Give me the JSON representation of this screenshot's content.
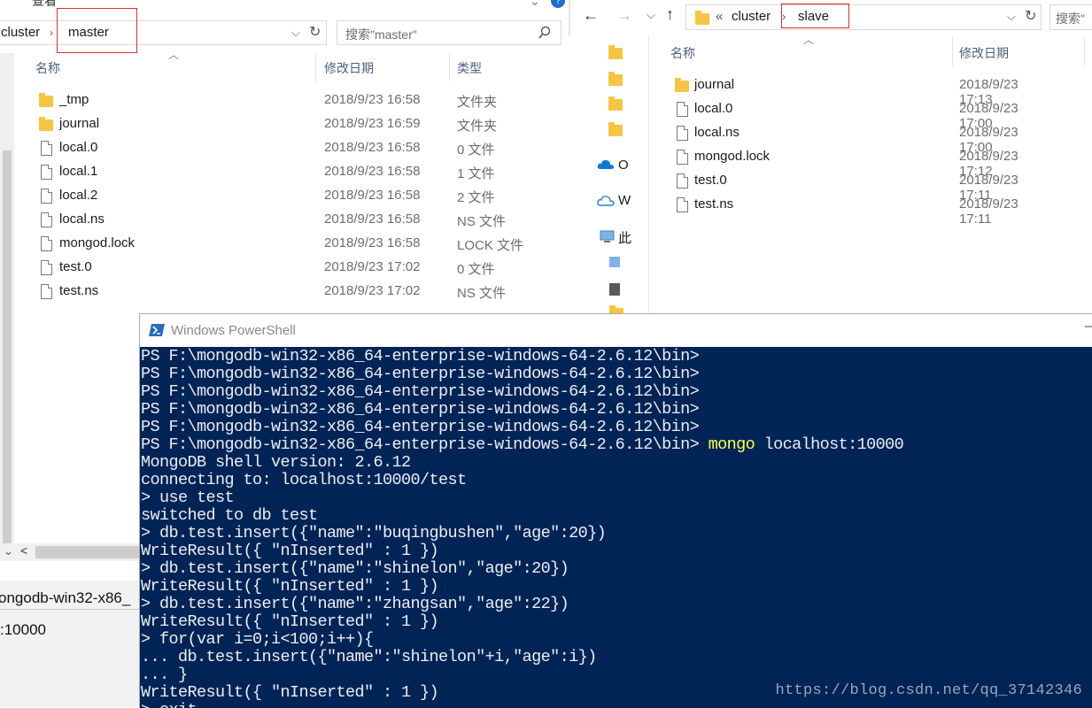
{
  "left_explorer": {
    "menu_label": "查看",
    "path": {
      "parent": "cluster",
      "current": "master"
    },
    "search_placeholder": "搜索\"master\"",
    "columns": {
      "name": "名称",
      "date": "修改日期",
      "type": "类型"
    },
    "files": [
      {
        "name": "_tmp",
        "date": "2018/9/23 16:58",
        "type": "文件夹",
        "kind": "folder"
      },
      {
        "name": "journal",
        "date": "2018/9/23 16:59",
        "type": "文件夹",
        "kind": "folder"
      },
      {
        "name": "local.0",
        "date": "2018/9/23 16:58",
        "type": "0 文件",
        "kind": "file"
      },
      {
        "name": "local.1",
        "date": "2018/9/23 16:58",
        "type": "1 文件",
        "kind": "file"
      },
      {
        "name": "local.2",
        "date": "2018/9/23 16:58",
        "type": "2 文件",
        "kind": "file"
      },
      {
        "name": "local.ns",
        "date": "2018/9/23 16:58",
        "type": "NS 文件",
        "kind": "file"
      },
      {
        "name": "mongod.lock",
        "date": "2018/9/23 16:58",
        "type": "LOCK 文件",
        "kind": "file"
      },
      {
        "name": "test.0",
        "date": "2018/9/23 17:02",
        "type": "0 文件",
        "kind": "file"
      },
      {
        "name": "test.ns",
        "date": "2018/9/23 17:02",
        "type": "NS 文件",
        "kind": "file"
      }
    ],
    "bottom_window_text_1": "ongodb-win32-x86_",
    "bottom_window_text_2": ":10000"
  },
  "right_explorer": {
    "path": {
      "overflow": "«",
      "parent": "cluster",
      "current": "slave"
    },
    "search_placeholder": "搜索\"",
    "columns": {
      "name": "名称",
      "date": "修改日期"
    },
    "nav_items": [
      "O",
      "W",
      "此"
    ],
    "files": [
      {
        "name": "journal",
        "date": "2018/9/23 17:13",
        "kind": "folder"
      },
      {
        "name": "local.0",
        "date": "2018/9/23 17:00",
        "kind": "file"
      },
      {
        "name": "local.ns",
        "date": "2018/9/23 17:00",
        "kind": "file"
      },
      {
        "name": "mongod.lock",
        "date": "2018/9/23 17:12",
        "kind": "file"
      },
      {
        "name": "test.0",
        "date": "2018/9/23 17:11",
        "kind": "file"
      },
      {
        "name": "test.ns",
        "date": "2018/9/23 17:11",
        "kind": "file"
      }
    ]
  },
  "powershell": {
    "title": "Windows PowerShell",
    "minimize_glyph": "—",
    "lines": [
      "PS F:\\mongodb-win32-x86_64-enterprise-windows-64-2.6.12\\bin>",
      "PS F:\\mongodb-win32-x86_64-enterprise-windows-64-2.6.12\\bin>",
      "PS F:\\mongodb-win32-x86_64-enterprise-windows-64-2.6.12\\bin>",
      "PS F:\\mongodb-win32-x86_64-enterprise-windows-64-2.6.12\\bin>",
      "PS F:\\mongodb-win32-x86_64-enterprise-windows-64-2.6.12\\bin>",
      "PS F:\\mongodb-win32-x86_64-enterprise-windows-64-2.6.12\\bin> ",
      "MongoDB shell version: 2.6.12",
      "connecting to: localhost:10000/test",
      "> use test",
      "switched to db test",
      "> db.test.insert({\"name\":\"buqingbushen\",\"age\":20})",
      "WriteResult({ \"nInserted\" : 1 })",
      "> db.test.insert({\"name\":\"shinelon\",\"age\":20})",
      "WriteResult({ \"nInserted\" : 1 })",
      "> db.test.insert({\"name\":\"zhangsan\",\"age\":22})",
      "WriteResult({ \"nInserted\" : 1 })",
      "> for(var i=0;i<100;i++){",
      "... db.test.insert({\"name\":\"shinelon\"+i,\"age\":i})",
      "... }",
      "WriteResult({ \"nInserted\" : 1 })",
      "> exit"
    ],
    "command_keyword": "mongo",
    "command_args": " localhost:10000",
    "watermark": "https://blog.csdn.net/qq_37142346"
  },
  "colors": {
    "ps_background": "#012456",
    "ps_text": "#eeedf0",
    "ps_command": "#fefe4f",
    "highlight_box": "#e02b2b"
  }
}
